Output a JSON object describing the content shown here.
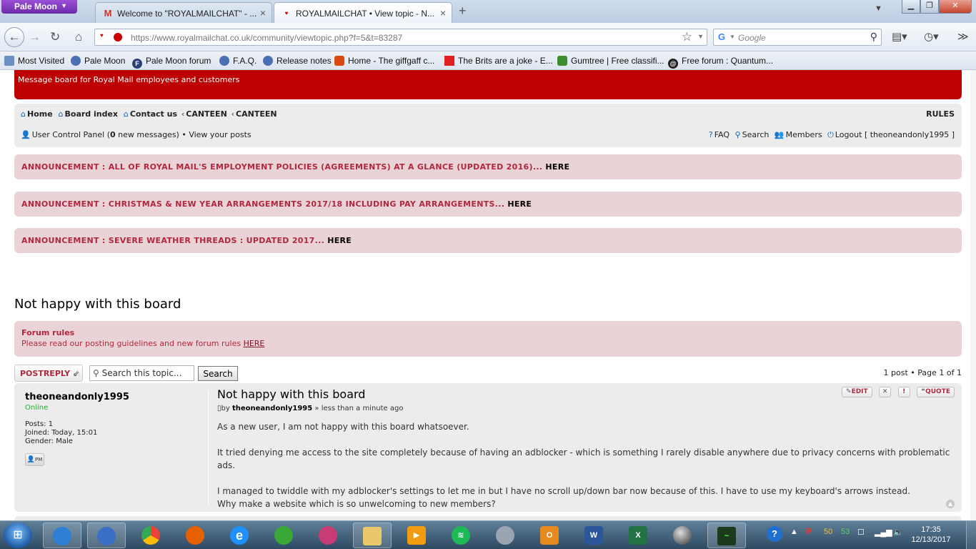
{
  "browser": {
    "app_button": "Pale Moon",
    "tabs": [
      {
        "title": "Welcome to \"ROYALMAILCHAT\" - ...",
        "favicon": "gmail-icon"
      },
      {
        "title": "ROYALMAILCHAT • View topic - N...",
        "favicon": "royalmailchat-icon"
      }
    ],
    "url_domain": "https://www.royalmailchat.co.uk",
    "url_path": "/community/viewtopic.php?f=5&t=83287",
    "search_placeholder": "Google",
    "bookmarks": [
      {
        "label": "Most Visited",
        "icon": "most-visited-icon"
      },
      {
        "label": "Pale Moon",
        "icon": "palemoon-icon"
      },
      {
        "label": "Pale Moon forum",
        "icon": "forum-icon"
      },
      {
        "label": "F.A.Q.",
        "icon": "palemoon-icon"
      },
      {
        "label": "Release notes",
        "icon": "palemoon-icon"
      },
      {
        "label": "Home - The giffgaff c...",
        "icon": "giffgaff-icon"
      },
      {
        "label": "The Brits are a joke - E...",
        "icon": "flag-icon"
      },
      {
        "label": "Gumtree | Free classifi...",
        "icon": "gumtree-icon"
      },
      {
        "label": "Free forum : Quantum...",
        "icon": "spiral-icon"
      }
    ]
  },
  "site": {
    "banner_text": "Message board for Royal Mail employees and customers",
    "breadcrumbs": {
      "home": "Home",
      "board_index": "Board index",
      "contact": "Contact us",
      "canteen1": "CANTEEN",
      "canteen2": "CANTEEN"
    },
    "rules": "RULES",
    "ucp": {
      "label": "User Control Panel (",
      "count": "0",
      "suffix": " new messages)",
      "sep": " • ",
      "view_posts": "View your posts"
    },
    "user_links": {
      "faq": "FAQ",
      "search": "Search",
      "members": "Members",
      "logout": "Logout [ theoneandonly1995 ]"
    },
    "announcements": [
      {
        "text": "ANNOUNCEMENT : ALL OF ROYAL MAIL'S EMPLOYMENT POLICIES (AGREEMENTS) AT A GLANCE (UPDATED 2016)...",
        "link": "HERE"
      },
      {
        "text": "ANNOUNCEMENT : CHRISTMAS & NEW YEAR ARRANGEMENTS 2017/18 INCLUDING PAY ARRANGEMENTS...",
        "link": "HERE"
      },
      {
        "text": "ANNOUNCEMENT : SEVERE WEATHER THREADS : UPDATED 2017...",
        "link": "HERE"
      }
    ],
    "topic_title": "Not happy with this board",
    "forum_rules": {
      "title": "Forum rules",
      "text": "Please read our posting guidelines and new forum rules ",
      "link": "HERE"
    },
    "toolbar": {
      "postreply": "POSTREPLY",
      "search_placeholder": "Search this topic...",
      "search_button": "Search",
      "pagination": "1 post • Page 1 of 1"
    },
    "post": {
      "author": "theoneandonly1995",
      "status": "Online",
      "posts_label": "Posts:",
      "posts_value": "1",
      "joined_label": "Joined:",
      "joined_value": "Today, 15:01",
      "gender_label": "Gender:",
      "gender_value": "Male",
      "pm_label": "PM",
      "title": "Not happy with this board",
      "meta_by": "by",
      "meta_author": "theoneandonly1995",
      "meta_time": "» less than a minute ago",
      "buttons": {
        "edit": "EDIT",
        "quote": "QUOTE"
      },
      "paragraphs": [
        "As a new user, I am not happy with this board whatsoever.",
        "It tried denying me access to the site completely because of having an adblocker - which is something I rarely disable anywhere due to privacy concerns with problematic ads.",
        "I managed to twiddle with my adblocker's settings to let me in but I have no scroll up/down bar now because of this. I have to use my keyboard's arrows instead.",
        "Why make a website which is so unwelcoming to new members?"
      ]
    }
  },
  "taskbar": {
    "items": [
      "ie-browser-icon",
      "palemoon-icon",
      "chrome-icon",
      "firefox-icon",
      "internet-explorer-icon",
      "xbox-icon",
      "spiral-app-icon",
      "file-explorer-icon",
      "media-player-icon",
      "spotify-icon",
      "speaker-app-icon",
      "outlook-icon",
      "word-icon",
      "excel-icon",
      "sphere-app-icon",
      "task-manager-icon"
    ],
    "tray_num1": "50",
    "tray_num2": "53",
    "time": "17:35",
    "date": "12/13/2017"
  },
  "colors": {
    "banner": "#bd0000",
    "announcement_bg": "#ead3d6",
    "announcement_text": "#b0283f",
    "online": "#21b02f"
  }
}
